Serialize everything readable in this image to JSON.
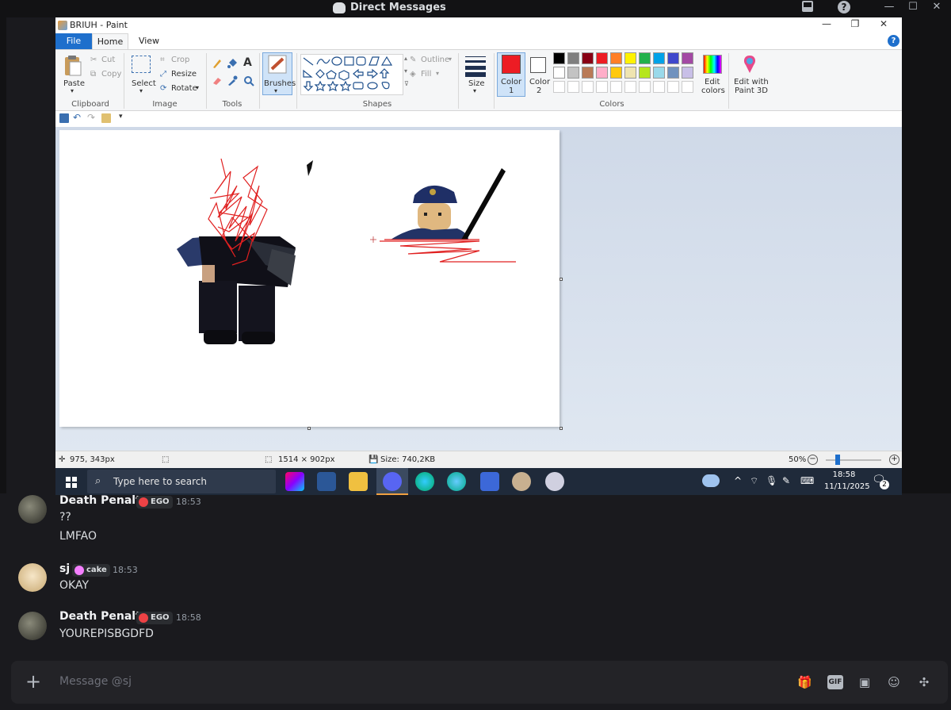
{
  "discord": {
    "window_title": "Direct Messages",
    "window_controls": {
      "minimize": "—",
      "maximize": "☐",
      "close": "✕"
    }
  },
  "paint": {
    "title": "BRIUH - Paint",
    "tabs": {
      "file": "File",
      "home": "Home",
      "view": "View"
    },
    "help": "?",
    "clipboard": {
      "paste": "Paste",
      "cut": "Cut",
      "copy": "Copy",
      "group": "Clipboard"
    },
    "image": {
      "select": "Select",
      "crop": "Crop",
      "resize": "Resize",
      "rotate": "Rotate",
      "group": "Image"
    },
    "tools": {
      "group": "Tools",
      "text_tool": "A"
    },
    "brushes": "Brushes",
    "shapes": {
      "outline": "Outline",
      "fill": "Fill",
      "group": "Shapes"
    },
    "size": "Size",
    "color1": {
      "label": "Color",
      "num": "1",
      "value": "#ed1c24"
    },
    "color2": {
      "label": "Color",
      "num": "2",
      "value": "#ffffff"
    },
    "palette_row1": [
      "#000000",
      "#7f7f7f",
      "#880015",
      "#ed1c24",
      "#ff7f27",
      "#fff200",
      "#22b14c",
      "#00a2e8",
      "#3f48cc",
      "#a349a4"
    ],
    "palette_row2": [
      "#ffffff",
      "#c3c3c3",
      "#b97a57",
      "#ffaec9",
      "#ffc90e",
      "#efe4b0",
      "#b5e61d",
      "#99d9ea",
      "#7092be",
      "#c8bfe7"
    ],
    "edit_colors": {
      "l1": "Edit",
      "l2": "colors"
    },
    "colors_group": "Colors",
    "paint3d": {
      "l1": "Edit with",
      "l2": "Paint 3D"
    },
    "status": {
      "cursor": "975, 343px",
      "selection": "1514 × 902px",
      "size": "Size: 740,2KB",
      "zoom": "50%"
    }
  },
  "taskbar": {
    "search_placeholder": "Type here to search",
    "time": "18:58",
    "date": "11/11/2025",
    "notifications": "2"
  },
  "chat": {
    "messages": [
      {
        "user": "Death Penalty",
        "badge": "EGO",
        "time": "18:53",
        "lines": [
          "??",
          "LMFAO"
        ]
      },
      {
        "user": "sj",
        "badge": "cake",
        "time": "18:53",
        "lines": [
          "OKAY"
        ]
      },
      {
        "user": "Death Penalty",
        "badge": "EGO",
        "time": "18:58",
        "lines": [
          "YOUREPISBGDFD"
        ]
      }
    ],
    "composer_placeholder": "Message @sj",
    "composer_plus": "+"
  },
  "colors": {
    "discord_bg": "#1a1a1e",
    "paint_blue": "#1e6fcc",
    "ego_badge": "#ed4245",
    "cake_badge": "#f47fff"
  }
}
